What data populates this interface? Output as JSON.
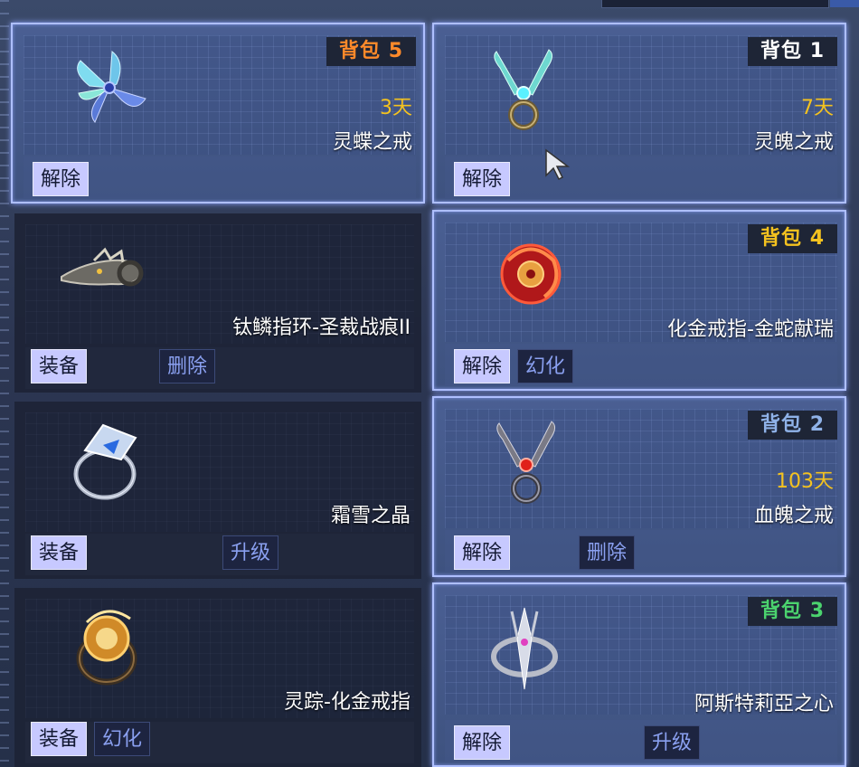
{
  "cards": [
    {
      "badge": "背包 5",
      "badge_color": "#ff8a2a",
      "days": "3天",
      "name": "灵蝶之戒",
      "buttons": [
        "解除"
      ],
      "icon": "butterfly-ring-icon"
    },
    {
      "badge": "背包 1",
      "badge_color": "#ffffff",
      "days": "7天",
      "name": "灵魄之戒",
      "buttons": [
        "解除"
      ],
      "icon": "soul-ring-icon"
    },
    {
      "name": "钛鳞指环-圣裁战痕II",
      "buttons": [
        "装备",
        "删除"
      ],
      "icon": "titanium-scale-ring-icon"
    },
    {
      "badge": "背包 4",
      "badge_color": "#f4c21f",
      "name": "化金戒指-金蛇献瑞",
      "buttons": [
        "解除",
        "幻化"
      ],
      "icon": "golden-snake-ring-icon"
    },
    {
      "name": "霜雪之晶",
      "buttons": [
        "装备",
        "升级"
      ],
      "icon": "frost-crystal-ring-icon"
    },
    {
      "badge": "背包 2",
      "badge_color": "#8fb2e8",
      "days": "103天",
      "name": "血魄之戒",
      "buttons": [
        "解除",
        "删除"
      ],
      "icon": "blood-soul-ring-icon"
    },
    {
      "name": "灵踪-化金戒指",
      "buttons": [
        "装备",
        "幻化"
      ],
      "icon": "spirit-trace-ring-icon"
    },
    {
      "badge": "背包 3",
      "badge_color": "#4bd36e",
      "name": "阿斯特莉亞之心",
      "buttons": [
        "解除",
        "升级"
      ],
      "icon": "astraea-heart-ring-icon"
    }
  ]
}
